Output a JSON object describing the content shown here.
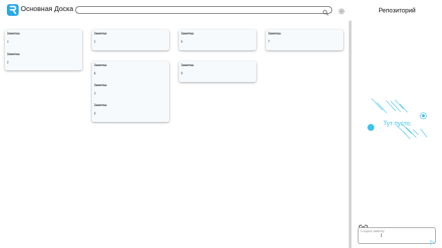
{
  "header": {
    "app_title": "Основная Доска",
    "search": {
      "value": "",
      "placeholder": ""
    }
  },
  "board": {
    "columns": [
      {
        "notes": [
          {
            "title": "Заметка",
            "text": "1"
          },
          {
            "title": "Заметка",
            "text": "2"
          }
        ]
      },
      {
        "notes": [
          {
            "title": "Заметка",
            "text": "5"
          }
        ]
      },
      {
        "notes": [
          {
            "title": "Заметка",
            "text": "6"
          }
        ]
      },
      {
        "notes": [
          {
            "title": "Заметка",
            "text": "7"
          }
        ]
      },
      {
        "notes": [
          {
            "title": "Заметка",
            "text": "8"
          },
          {
            "title": "Заметка",
            "text": "3"
          },
          {
            "title": "Заметка",
            "text": "4"
          }
        ]
      },
      {
        "notes": [
          {
            "title": "Заметка",
            "text": "9"
          }
        ]
      }
    ]
  },
  "repository": {
    "title": "Репозиторий",
    "empty_text": "Тут пусто.",
    "create_placeholder": "Создать заметку"
  },
  "colors": {
    "accent": "#2aa8e6",
    "empty_art": "#3cc3ee",
    "card_bg": "#f7fafd"
  },
  "icons": [
    "logo-icon",
    "search-icon",
    "gear-icon",
    "link-icon",
    "send-icon"
  ]
}
